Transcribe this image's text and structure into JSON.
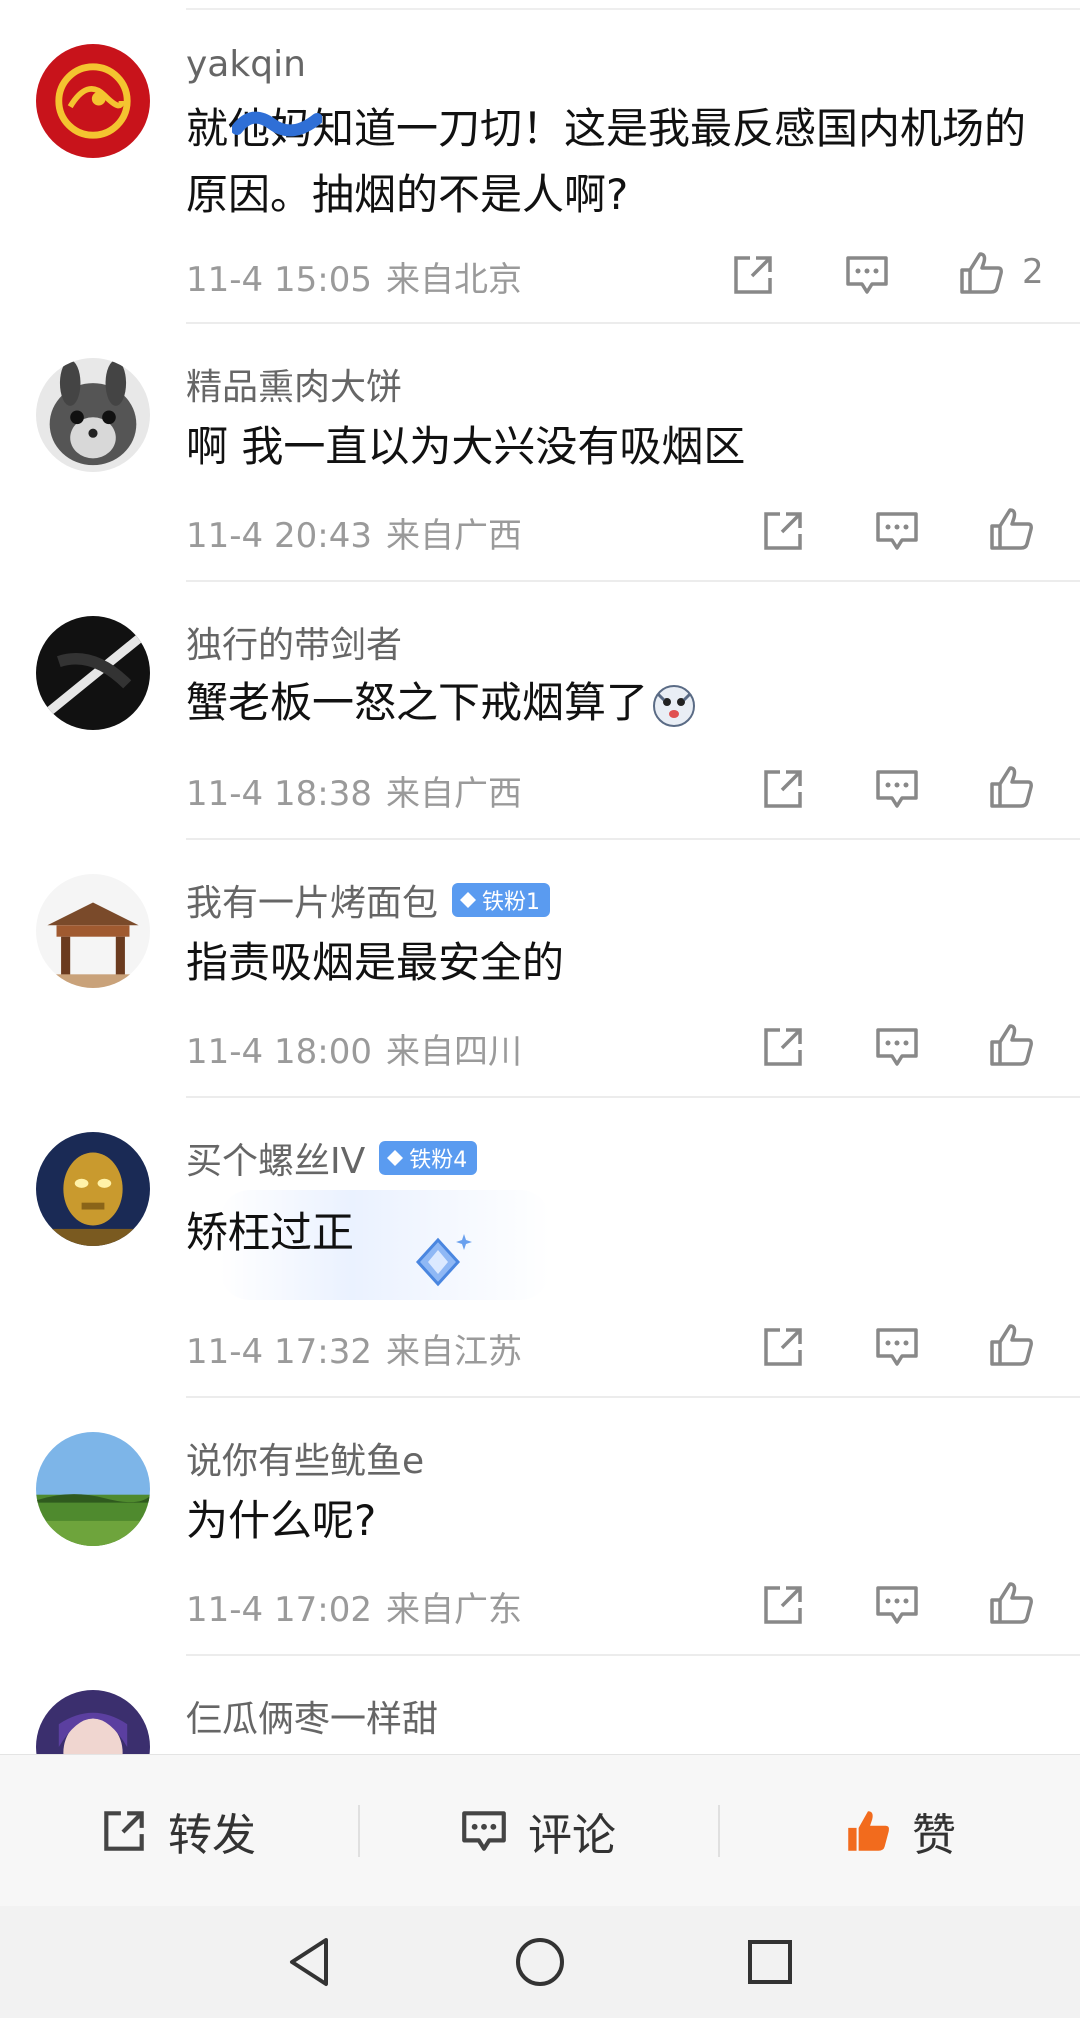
{
  "comments": [
    {
      "username": "yakqin",
      "text": "就他妈知道一刀切！这是我最反感国内机场的原因。抽烟的不是人啊?",
      "date": "11-4 15:05",
      "location": "来自北京",
      "like_count": "2"
    },
    {
      "username": "精品熏肉大饼",
      "text": "啊 我一直以为大兴没有吸烟区",
      "date": "11-4 20:43",
      "location": "来自广西"
    },
    {
      "username": "独行的带剑者",
      "text": "蟹老板一怒之下戒烟算了",
      "date": "11-4 18:38",
      "location": "来自广西"
    },
    {
      "username": "我有一片烤面包",
      "badge": "铁粉1",
      "text": "指责吸烟是最安全的",
      "date": "11-4 18:00",
      "location": "来自四川"
    },
    {
      "username": "买个螺丝IV",
      "badge": "铁粉4",
      "text": "矫枉过正",
      "date": "11-4 17:32",
      "location": "来自江苏"
    },
    {
      "username": "说你有些鱿鱼e",
      "text": "为什么呢?",
      "date": "11-4 17:02",
      "location": "来自广东"
    },
    {
      "username": "仨瓜俩枣一样甜"
    }
  ],
  "action_bar": {
    "repost": "转发",
    "comment": "评论",
    "like": "赞"
  },
  "colors": {
    "accent_like": "#f26b1d",
    "badge_bg": "#5a9bf0",
    "meta_text": "#9a9a9a"
  },
  "icons": [
    "repost-icon",
    "comment-icon",
    "like-icon",
    "back-icon",
    "home-icon",
    "recents-icon"
  ]
}
